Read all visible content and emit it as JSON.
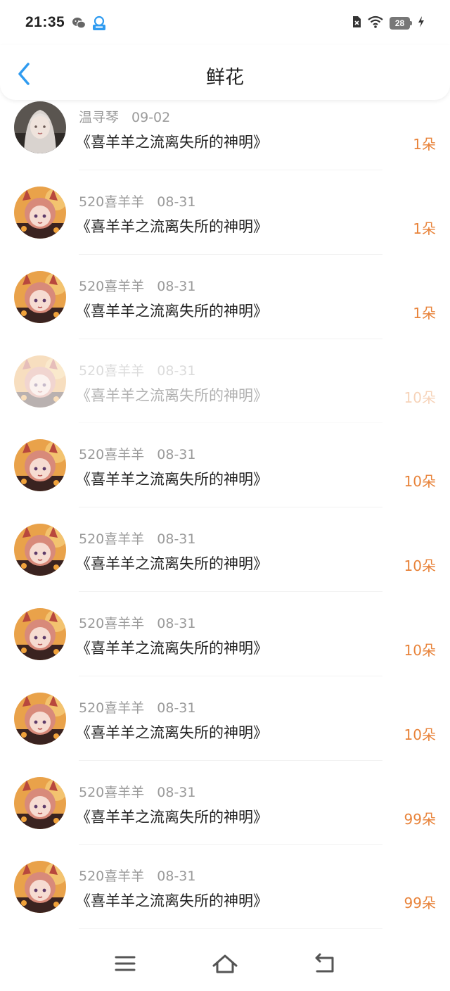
{
  "status_bar": {
    "time": "21:35",
    "left_icons": [
      "wechat-icon",
      "app-notification-icon"
    ],
    "right_icons": [
      "sim-off-icon",
      "wifi-icon",
      "battery-icon",
      "charging-icon"
    ],
    "battery_level": "28"
  },
  "header": {
    "back_icon": "chevron-left-icon",
    "title": "鲜花"
  },
  "rows": [
    {
      "user": "温寻琴",
      "date": "09-02",
      "title": "《喜羊羊之流离失所的神明》",
      "amount": "1朵",
      "avatar": "avatar-portrait"
    },
    {
      "user": "520喜羊羊",
      "date": "08-31",
      "title": "《喜羊羊之流离失所的神明》",
      "amount": "1朵",
      "avatar": "avatar-anime"
    },
    {
      "user": "520喜羊羊",
      "date": "08-31",
      "title": "《喜羊羊之流离失所的神明》",
      "amount": "1朵",
      "avatar": "avatar-anime"
    },
    {
      "user": "520喜羊羊",
      "date": "08-31",
      "title": "《喜羊羊之流离失所的神明》",
      "amount": "10朵",
      "avatar": "avatar-anime",
      "faded": true
    },
    {
      "user": "520喜羊羊",
      "date": "08-31",
      "title": "《喜羊羊之流离失所的神明》",
      "amount": "10朵",
      "avatar": "avatar-anime"
    },
    {
      "user": "520喜羊羊",
      "date": "08-31",
      "title": "《喜羊羊之流离失所的神明》",
      "amount": "10朵",
      "avatar": "avatar-anime"
    },
    {
      "user": "520喜羊羊",
      "date": "08-31",
      "title": "《喜羊羊之流离失所的神明》",
      "amount": "10朵",
      "avatar": "avatar-anime"
    },
    {
      "user": "520喜羊羊",
      "date": "08-31",
      "title": "《喜羊羊之流离失所的神明》",
      "amount": "10朵",
      "avatar": "avatar-anime"
    },
    {
      "user": "520喜羊羊",
      "date": "08-31",
      "title": "《喜羊羊之流离失所的神明》",
      "amount": "99朵",
      "avatar": "avatar-anime"
    },
    {
      "user": "520喜羊羊",
      "date": "08-31",
      "title": "《喜羊羊之流离失所的神明》",
      "amount": "99朵",
      "avatar": "avatar-anime"
    }
  ],
  "nav_bar": {
    "icons": [
      "menu-icon",
      "home-icon",
      "back-icon"
    ]
  },
  "colors": {
    "accent_blue": "#2f9bf0",
    "amount_orange": "#e8833a",
    "meta_gray": "#9a9a9a"
  }
}
